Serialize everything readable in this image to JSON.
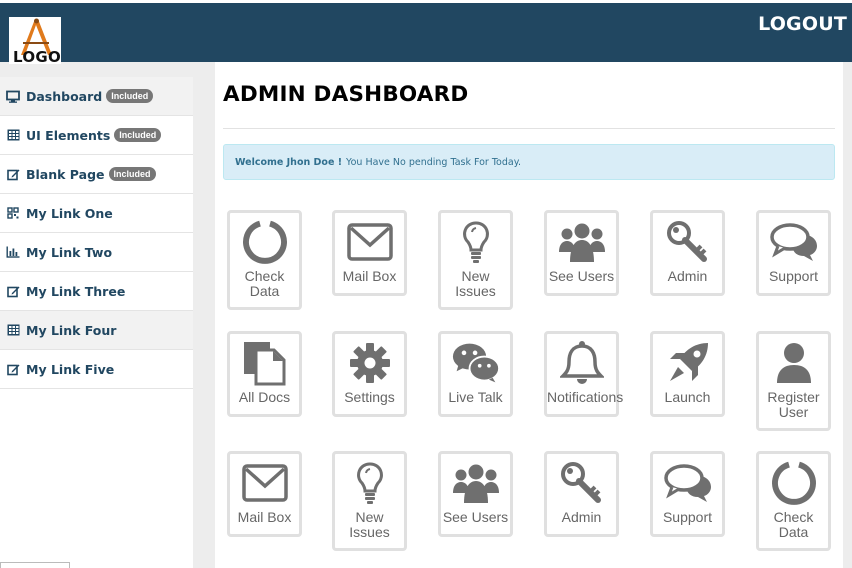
{
  "header": {
    "logo_text": "LOGO",
    "logout_label": "LOGOUT"
  },
  "sidebar": {
    "items": [
      {
        "label": "Dashboard",
        "badge": "Included",
        "icon": "desktop-icon"
      },
      {
        "label": "UI Elements",
        "badge": "Included",
        "icon": "table-icon"
      },
      {
        "label": "Blank Page",
        "badge": "Included",
        "icon": "edit-icon"
      },
      {
        "label": "My Link One",
        "badge": "",
        "icon": "qrcode-icon"
      },
      {
        "label": "My Link Two",
        "badge": "",
        "icon": "bar-chart-icon"
      },
      {
        "label": "My Link Three",
        "badge": "",
        "icon": "edit-icon"
      },
      {
        "label": "My Link Four",
        "badge": "",
        "icon": "table-icon"
      },
      {
        "label": "My Link Five",
        "badge": "",
        "icon": "edit-icon"
      }
    ]
  },
  "main": {
    "title": "ADMIN DASHBOARD",
    "alert": {
      "strong": "Welcome Jhon Doe !",
      "text": "You Have No pending Task For Today."
    },
    "tiles": [
      {
        "label": "Check Data",
        "icon": "circle-notch-icon"
      },
      {
        "label": "Mail Box",
        "icon": "envelope-icon"
      },
      {
        "label": "New Issues",
        "icon": "lightbulb-icon"
      },
      {
        "label": "See Users",
        "icon": "users-icon"
      },
      {
        "label": "Admin",
        "icon": "key-icon"
      },
      {
        "label": "Support",
        "icon": "comments-icon"
      },
      {
        "label": "All Docs",
        "icon": "copy-icon"
      },
      {
        "label": "Settings",
        "icon": "gear-icon"
      },
      {
        "label": "Live Talk",
        "icon": "wechat-icon"
      },
      {
        "label": "Notifications",
        "icon": "bell-icon"
      },
      {
        "label": "Launch",
        "icon": "rocket-icon"
      },
      {
        "label": "Register User",
        "icon": "user-icon"
      },
      {
        "label": "Mail Box",
        "icon": "envelope-icon"
      },
      {
        "label": "New Issues",
        "icon": "lightbulb-icon"
      },
      {
        "label": "See Users",
        "icon": "users-icon"
      },
      {
        "label": "Admin",
        "icon": "key-icon"
      },
      {
        "label": "Support",
        "icon": "comments-icon"
      },
      {
        "label": "Check Data",
        "icon": "circle-notch-icon"
      }
    ]
  },
  "colors": {
    "header_bg": "#214761",
    "nav_text": "#214761",
    "icon_gray": "#6f6f6f",
    "alert_bg": "#d9edf7"
  }
}
